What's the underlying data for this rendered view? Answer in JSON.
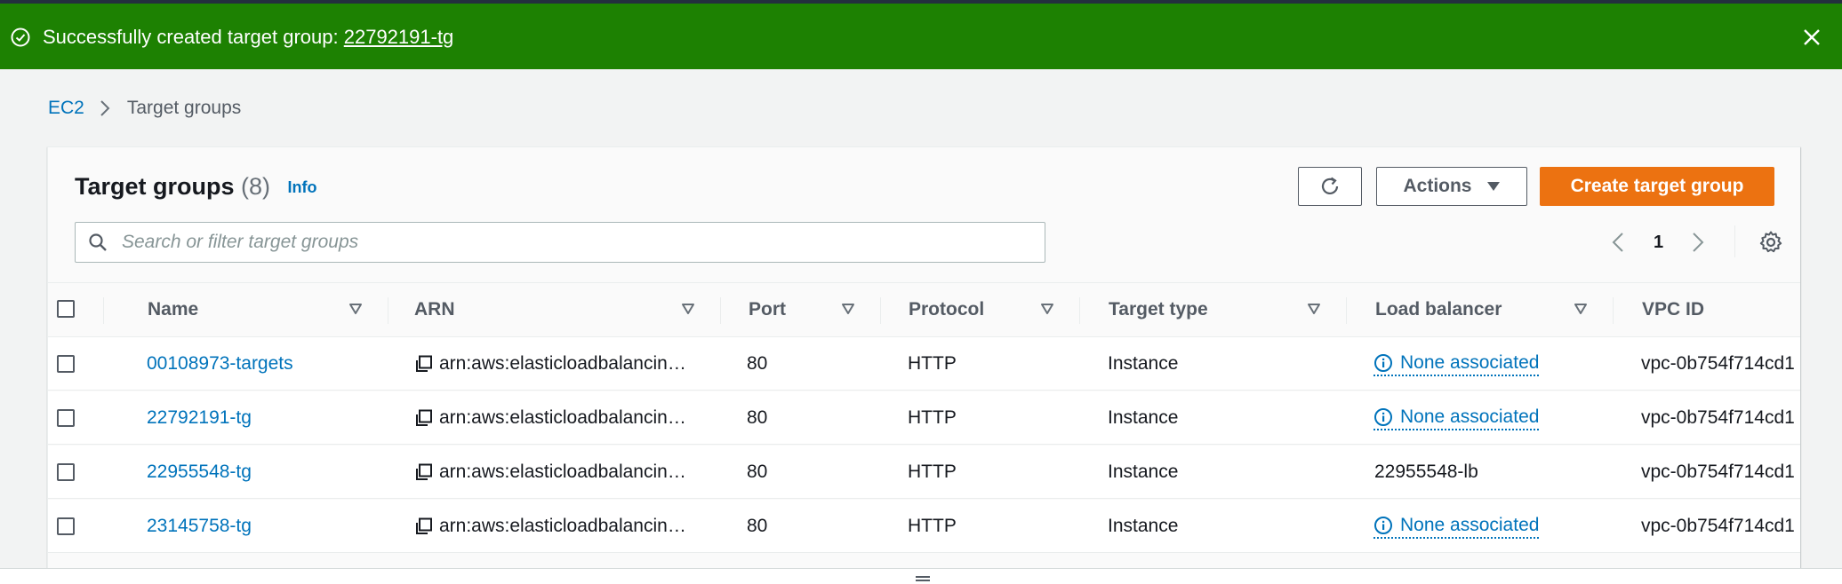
{
  "flash": {
    "message": "Successfully created target group: ",
    "link": "22792191-tg",
    "color": "#1d8102"
  },
  "breadcrumb": {
    "root": "EC2",
    "current": "Target groups"
  },
  "panel": {
    "title": "Target groups",
    "count": "(8)",
    "info": "Info",
    "actions_label": "Actions",
    "create_label": "Create target group",
    "search_placeholder": "Search or filter target groups",
    "search_value": "",
    "page": "1"
  },
  "columns": [
    "Name",
    "ARN",
    "Port",
    "Protocol",
    "Target type",
    "Load balancer",
    "VPC ID"
  ],
  "rows": [
    {
      "name": "00108973-targets",
      "arn": "arn:aws:elasticloadbalancin…",
      "port": "80",
      "protocol": "HTTP",
      "target_type": "Instance",
      "load_balancer": "None associated",
      "lb_none": true,
      "vpc": "vpc-0b754f714cd1"
    },
    {
      "name": "22792191-tg",
      "arn": "arn:aws:elasticloadbalancin…",
      "port": "80",
      "protocol": "HTTP",
      "target_type": "Instance",
      "load_balancer": "None associated",
      "lb_none": true,
      "vpc": "vpc-0b754f714cd1"
    },
    {
      "name": "22955548-tg",
      "arn": "arn:aws:elasticloadbalancin…",
      "port": "80",
      "protocol": "HTTP",
      "target_type": "Instance",
      "load_balancer": "22955548-lb",
      "lb_none": false,
      "vpc": "vpc-0b754f714cd1"
    },
    {
      "name": "23145758-tg",
      "arn": "arn:aws:elasticloadbalancin…",
      "port": "80",
      "protocol": "HTTP",
      "target_type": "Instance",
      "load_balancer": "None associated",
      "lb_none": true,
      "vpc": "vpc-0b754f714cd1"
    }
  ],
  "colors": {
    "link": "#0073bb",
    "primary_button": "#ec7211",
    "text": "#16191f",
    "secondary_text": "#545b64"
  }
}
